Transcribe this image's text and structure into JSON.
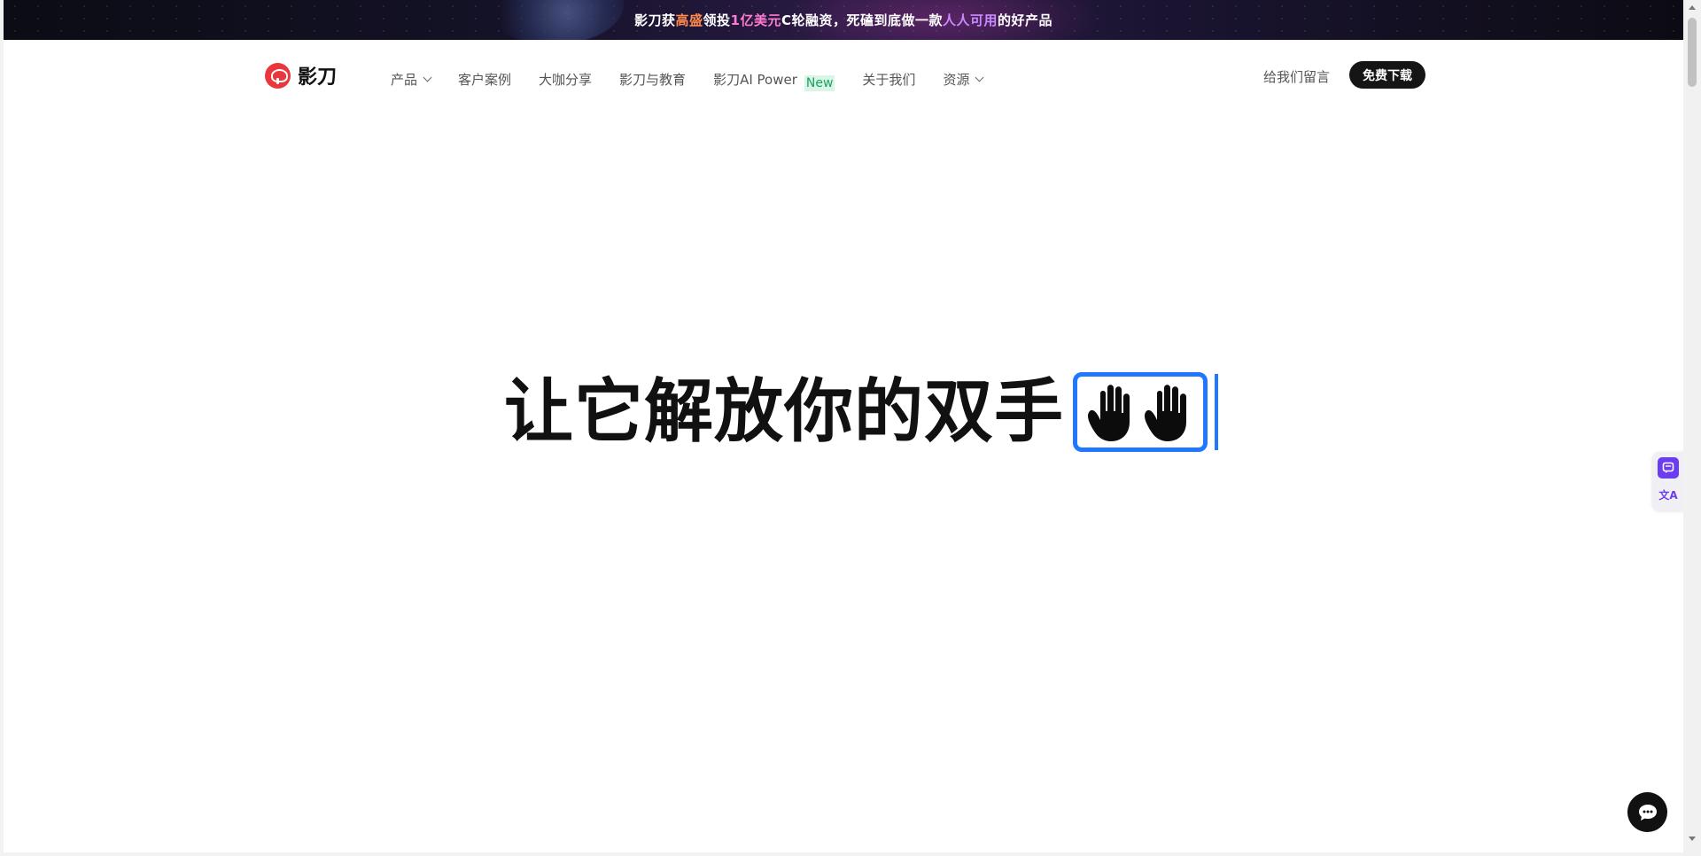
{
  "banner": {
    "part1": "影刀获",
    "part2": "高盛",
    "part3": "领投",
    "part4": "1亿美元",
    "part5": "C轮融资，死磕到底做一款",
    "part6": "人人可用",
    "part7": "的好产品"
  },
  "nav": {
    "logo_text": "影刀",
    "items": [
      {
        "label": "产品",
        "has_dropdown": true
      },
      {
        "label": "客户案例"
      },
      {
        "label": "大咖分享"
      },
      {
        "label": "影刀与教育"
      },
      {
        "label": "影刀AI Power",
        "badge": "New"
      },
      {
        "label": "关于我们"
      },
      {
        "label": "资源",
        "has_dropdown": true
      }
    ],
    "message_link": "给我们留言",
    "download_button": "免费下载"
  },
  "hero": {
    "title": "让它解放你的双手",
    "emoji_icon": "raised-hands-icon"
  },
  "side_tools": {
    "icons": [
      "feedback-icon",
      "translate-icon"
    ],
    "translate_glyph": "文A"
  },
  "chat": {
    "icon": "chat-bubble-icon"
  },
  "colors": {
    "accent_blue": "#1f78ff",
    "logo_red": "#e8383d",
    "new_badge_green": "#1aa260",
    "tool_purple": "#6c3df0"
  }
}
